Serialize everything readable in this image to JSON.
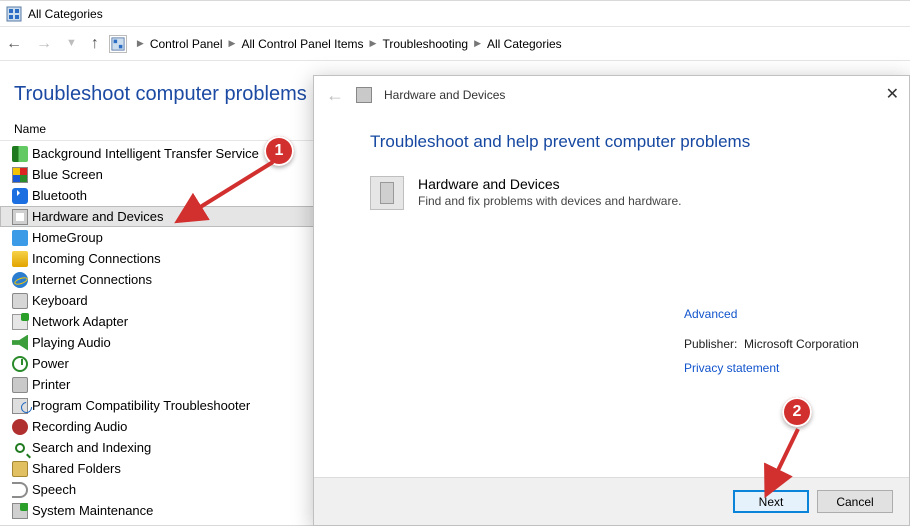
{
  "window": {
    "title": "All Categories"
  },
  "breadcrumb": {
    "items": [
      "Control Panel",
      "All Control Panel Items",
      "Troubleshooting",
      "All Categories"
    ]
  },
  "header": {
    "title": "Troubleshoot computer problems"
  },
  "columns": {
    "name_label": "Name"
  },
  "list": {
    "items": [
      {
        "label": "Background Intelligent Transfer Service",
        "icon": "ic-bits"
      },
      {
        "label": "Blue Screen",
        "icon": "ic-bsod"
      },
      {
        "label": "Bluetooth",
        "icon": "ic-bt"
      },
      {
        "label": "Hardware and Devices",
        "icon": "ic-hw",
        "selected": true
      },
      {
        "label": "HomeGroup",
        "icon": "ic-hg"
      },
      {
        "label": "Incoming Connections",
        "icon": "ic-inc"
      },
      {
        "label": "Internet Connections",
        "icon": "ic-ie"
      },
      {
        "label": "Keyboard",
        "icon": "ic-kb"
      },
      {
        "label": "Network Adapter",
        "icon": "ic-net"
      },
      {
        "label": "Playing Audio",
        "icon": "ic-audio"
      },
      {
        "label": "Power",
        "icon": "ic-power"
      },
      {
        "label": "Printer",
        "icon": "ic-print"
      },
      {
        "label": "Program Compatibility Troubleshooter",
        "icon": "ic-compat"
      },
      {
        "label": "Recording Audio",
        "icon": "ic-rec"
      },
      {
        "label": "Search and Indexing",
        "icon": "ic-search"
      },
      {
        "label": "Shared Folders",
        "icon": "ic-shared"
      },
      {
        "label": "Speech",
        "icon": "ic-speech"
      },
      {
        "label": "System Maintenance",
        "icon": "ic-maint"
      }
    ]
  },
  "wizard": {
    "title": "Hardware and Devices",
    "heading": "Troubleshoot and help prevent computer problems",
    "item_title": "Hardware and Devices",
    "item_desc": "Find and fix problems with devices and hardware.",
    "advanced_label": "Advanced",
    "publisher_label": "Publisher:",
    "publisher_value": "Microsoft Corporation",
    "privacy_label": "Privacy statement",
    "next_label": "Next",
    "cancel_label": "Cancel"
  },
  "annotations": {
    "badge1": "1",
    "badge2": "2"
  }
}
